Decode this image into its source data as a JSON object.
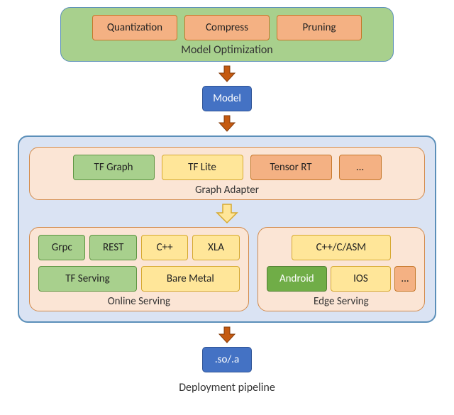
{
  "caption": "Deployment pipeline",
  "optimization": {
    "label": "Model Optimization",
    "items": [
      "Quantization",
      "Compress",
      "Pruning"
    ]
  },
  "model_box": "Model",
  "pipeline": {
    "adapter": {
      "label": "Graph Adapter",
      "items": [
        "TF Graph",
        "TF Lite",
        "Tensor RT",
        "..."
      ]
    },
    "online": {
      "label": "Online Serving",
      "protocols": [
        "Grpc",
        "REST",
        "C++",
        "XLA"
      ],
      "backends": [
        "TF Serving",
        "Bare Metal"
      ]
    },
    "edge": {
      "label": "Edge Serving",
      "lang": "C++/C/ASM",
      "platforms": [
        "Android",
        "IOS",
        "..."
      ]
    }
  },
  "output_box": ".so/.a"
}
